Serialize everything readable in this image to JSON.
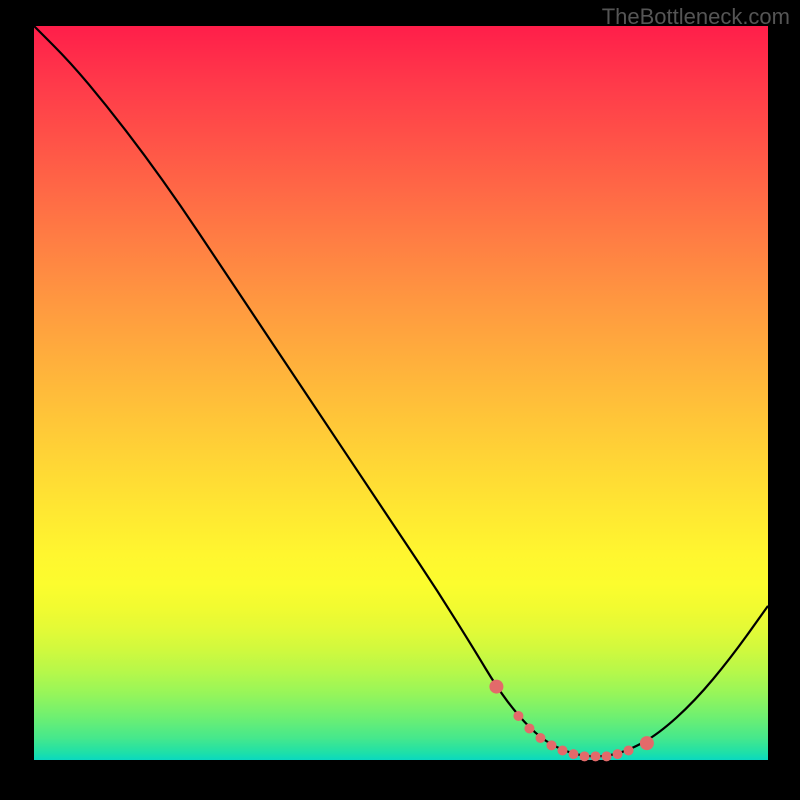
{
  "watermark": "TheBottleneck.com",
  "chart_data": {
    "type": "line",
    "title": "",
    "xlabel": "",
    "ylabel": "",
    "xlim": [
      0,
      100
    ],
    "ylim": [
      0,
      100
    ],
    "series": [
      {
        "name": "bottleneck-curve",
        "x": [
          0,
          5,
          10,
          15,
          20,
          25,
          30,
          35,
          40,
          45,
          50,
          55,
          60,
          63,
          66,
          69,
          72,
          75,
          78,
          81,
          85,
          90,
          95,
          100
        ],
        "y": [
          100,
          95,
          89,
          82.5,
          75.5,
          68,
          60.5,
          53,
          45.5,
          38,
          30.5,
          23,
          15,
          10,
          6,
          3,
          1.3,
          0.5,
          0.5,
          1.3,
          3.5,
          8,
          14,
          21
        ]
      }
    ],
    "markers": {
      "name": "highlighted-points",
      "color": "#e36a6a",
      "x": [
        63,
        66,
        67.5,
        69,
        70.5,
        72,
        73.5,
        75,
        76.5,
        78,
        79.5,
        81,
        83.5
      ],
      "y": [
        10,
        6,
        4.3,
        3,
        2,
        1.3,
        0.8,
        0.5,
        0.5,
        0.5,
        0.8,
        1.3,
        2.3
      ]
    },
    "gradient_stops": [
      {
        "pos": 0.0,
        "color": "#ff1e4a"
      },
      {
        "pos": 0.5,
        "color": "#ffb63b"
      },
      {
        "pos": 0.78,
        "color": "#fcfc2e"
      },
      {
        "pos": 0.92,
        "color": "#96f55a"
      },
      {
        "pos": 1.0,
        "color": "#0ad8c0"
      }
    ]
  }
}
